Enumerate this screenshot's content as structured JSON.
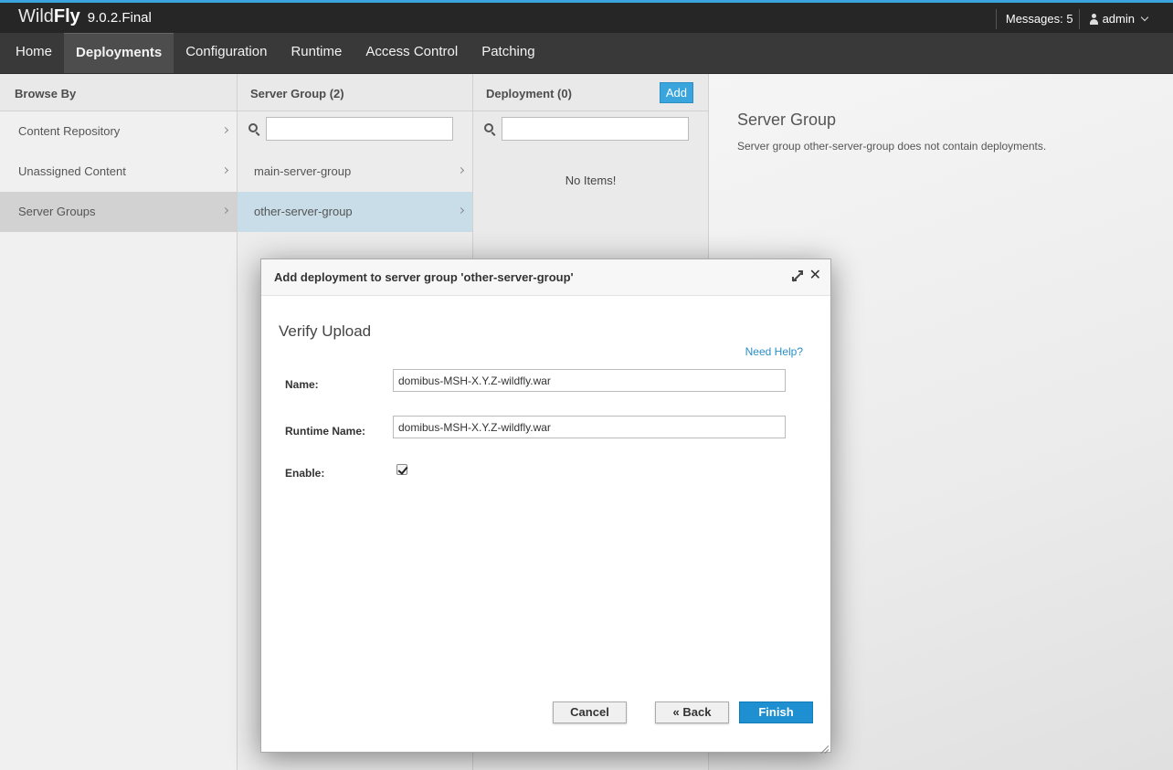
{
  "header": {
    "brand_light": "Wild",
    "brand_bold": "Fly",
    "version": "9.0.2.Final",
    "messages": "Messages: 5",
    "user": "admin"
  },
  "nav": {
    "items": [
      "Home",
      "Deployments",
      "Configuration",
      "Runtime",
      "Access Control",
      "Patching"
    ],
    "active": "Deployments"
  },
  "browse_by": {
    "title": "Browse By",
    "items": [
      "Content Repository",
      "Unassigned Content",
      "Server Groups"
    ],
    "selected": "Server Groups"
  },
  "server_group": {
    "title": "Server Group (2)",
    "items": [
      "main-server-group",
      "other-server-group"
    ],
    "selected": "other-server-group"
  },
  "deployment": {
    "title": "Deployment (0)",
    "add_label": "Add",
    "empty_text": "No Items!"
  },
  "detail": {
    "title": "Server Group",
    "text": "Server group other-server-group does not contain deployments."
  },
  "modal": {
    "title": "Add deployment to server group 'other-server-group'",
    "step_title": "Verify Upload",
    "help": "Need Help?",
    "name_label": "Name:",
    "name_value": "domibus-MSH-X.Y.Z-wildfly.war",
    "runtime_label": "Runtime Name:",
    "runtime_value": "domibus-MSH-X.Y.Z-wildfly.war",
    "enable_label": "Enable:",
    "enable_checked": true,
    "cancel": "Cancel",
    "back": "« Back",
    "finish": "Finish"
  },
  "icons": {
    "user": "user-icon",
    "search": "search-icon",
    "maximize": "maximize-icon",
    "close": "close-icon"
  }
}
